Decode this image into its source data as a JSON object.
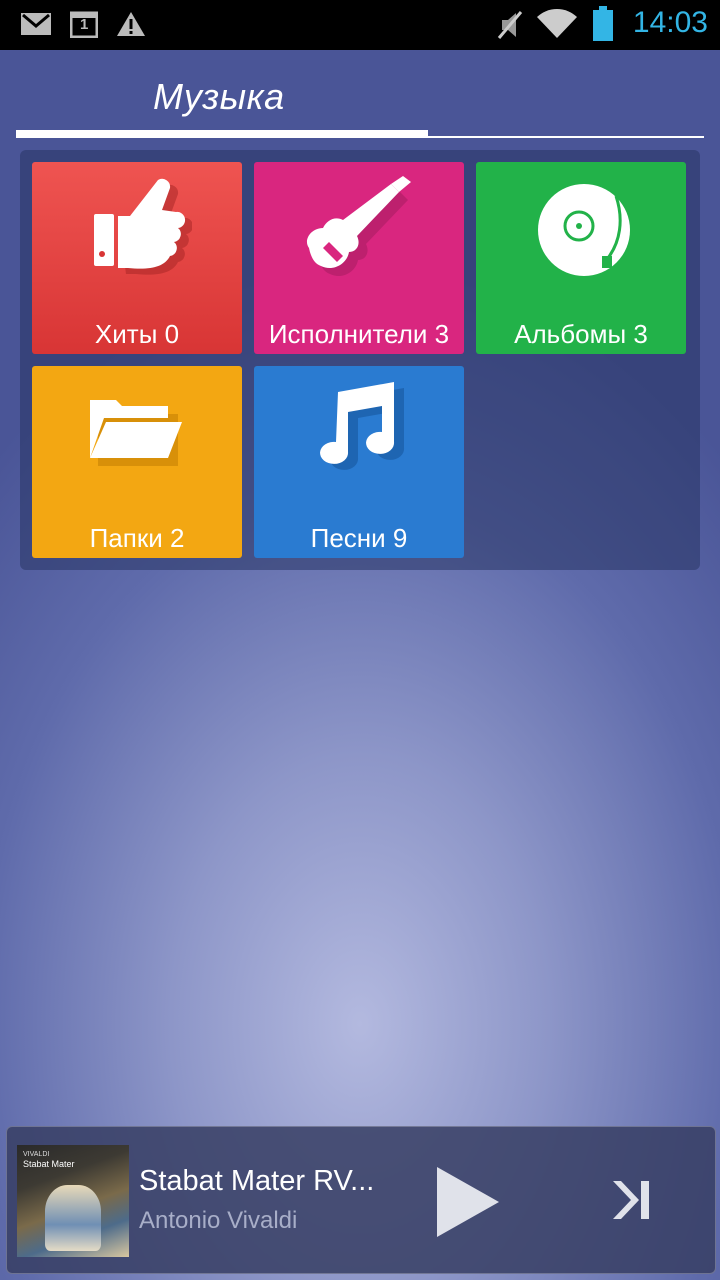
{
  "status_bar": {
    "time": "14:03",
    "icons": [
      "gmail-icon",
      "calendar-icon",
      "warning-icon",
      "mute-icon",
      "wifi-icon",
      "battery-icon"
    ],
    "calendar_day": "1",
    "time_color": "#33b5e5"
  },
  "header": {
    "title": "Музыка"
  },
  "tiles": [
    {
      "label": "Хиты 0",
      "icon": "thumbs-up-icon",
      "color": "#e44343"
    },
    {
      "label": "Исполнители 3",
      "icon": "guitar-icon",
      "color": "#d9267f"
    },
    {
      "label": "Альбомы 3",
      "icon": "turntable-icon",
      "color": "#22b249"
    },
    {
      "label": "Папки 2",
      "icon": "folder-icon",
      "color": "#f3a712"
    },
    {
      "label": "Песни 9",
      "icon": "music-note-icon",
      "color": "#2a7bd1"
    }
  ],
  "now_playing": {
    "title": "Stabat Mater RV...",
    "artist": "Antonio Vivaldi",
    "cover_composer": "VIVALDI",
    "cover_title": "Stabat Mater"
  }
}
